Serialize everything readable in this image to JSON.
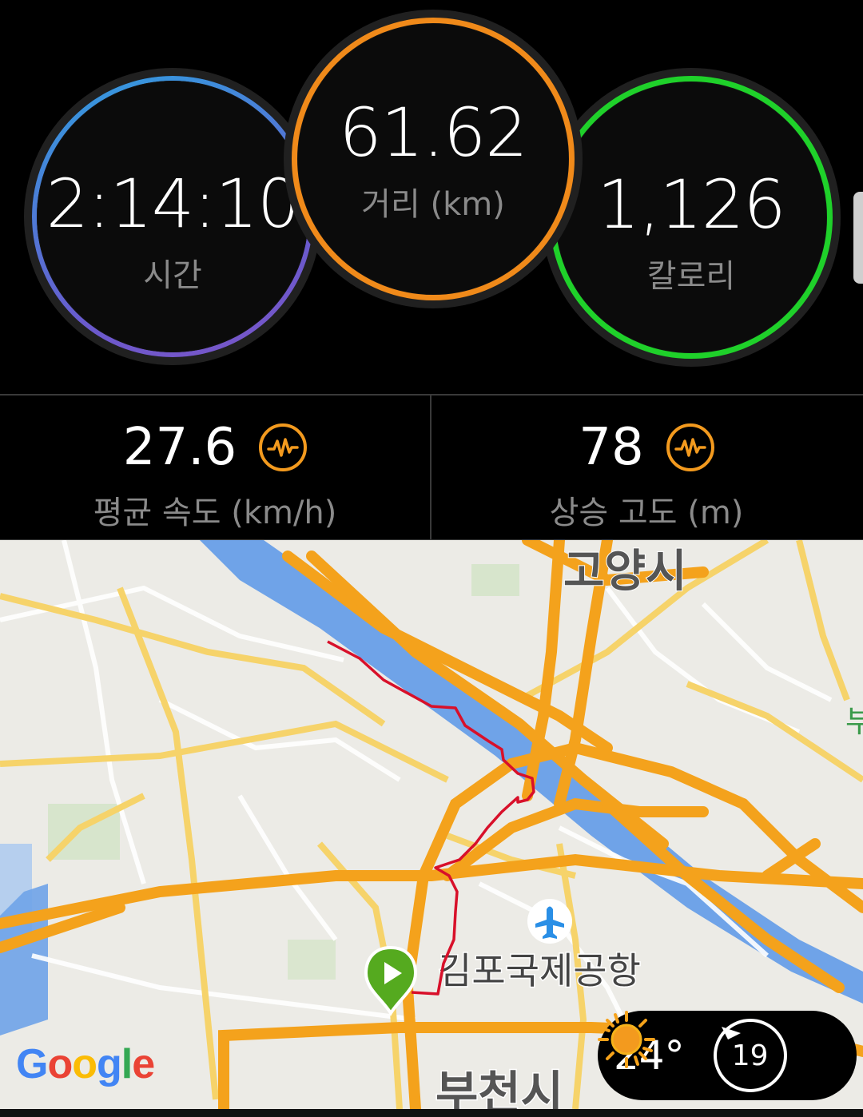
{
  "rings": {
    "time": {
      "value": "2:14:10",
      "label": "시간",
      "color": "#3f8fe0"
    },
    "distance": {
      "value": "61.62",
      "label": "거리 (km)",
      "color": "#f08a1a"
    },
    "calories": {
      "value": "1,126",
      "label": "칼로리",
      "color": "#1fd12a"
    }
  },
  "stats": {
    "avg_speed": {
      "value": "27.6",
      "label": "평균 속도 (km/h)",
      "icon": "pulse-icon"
    },
    "elevation_gain": {
      "value": "78",
      "label": "상승 고도 (m)",
      "icon": "pulse-icon"
    }
  },
  "map": {
    "labels": {
      "goyang": "고양시",
      "gimpo_airport": "김포국제공항",
      "bucheon": "부천시",
      "edge": "부"
    },
    "attribution": "Google",
    "start_marker": "play-icon",
    "airport_icon": "airplane-icon"
  },
  "weather": {
    "temperature": "24°",
    "condition": "sun-icon",
    "wind_speed": "19"
  },
  "colors": {
    "accent_orange": "#f39a1e",
    "route_red": "#d8102a",
    "river": "#6fa3e8",
    "road": "#f4a21c"
  }
}
